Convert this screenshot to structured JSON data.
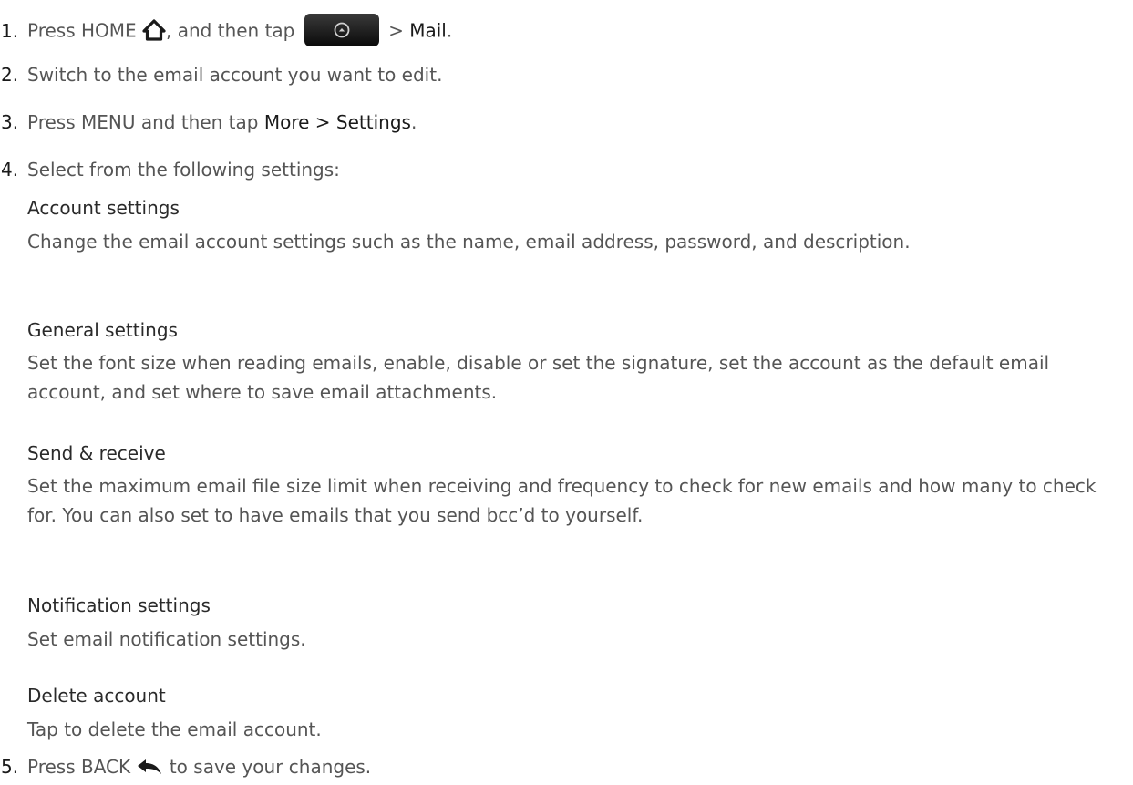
{
  "steps": [
    {
      "number": "1.",
      "text_before": "Press HOME",
      "text_middle": ", and then tap",
      "text_sep": " > ",
      "text_highlight": "Mail",
      "text_after": "."
    },
    {
      "number": "2.",
      "text": "Switch to the email account you want to edit."
    },
    {
      "number": "3.",
      "text_before": "Press MENU and then tap ",
      "text_highlight": "More > Settings",
      "text_after": "."
    },
    {
      "number": "4.",
      "text": "Select from the following settings:"
    },
    {
      "number": "5.",
      "text_before": "Press BACK",
      "text_after": " to save your changes."
    }
  ],
  "settings": [
    {
      "title": "Account settings",
      "description": "Change the email account settings such as the name, email address, password, and description."
    },
    {
      "title": "General settings",
      "description": "Set the font size when reading emails, enable, disable or set the signature, set the account as the default email account, and set where to save email attachments."
    },
    {
      "title": "Send & receive",
      "description": "Set the maximum email file size limit when receiving and frequency to check for new emails and how many to check for. You can also set to have emails that you send bcc’d to yourself."
    },
    {
      "title": "Notification settings",
      "description": "Set email notification settings."
    },
    {
      "title": "Delete account",
      "description": "Tap to delete the email account."
    }
  ],
  "icons": {
    "home": "home-icon",
    "all_apps": "all-apps-button-icon",
    "back": "back-arrow-icon"
  }
}
